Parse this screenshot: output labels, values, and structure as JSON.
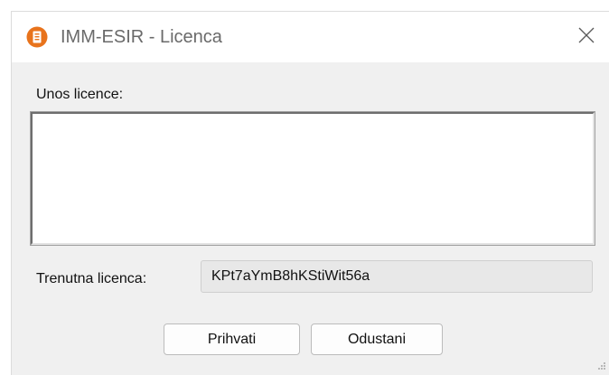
{
  "window": {
    "title": "IMM-ESIR - Licenca",
    "app_icon": "app-logo-icon",
    "close_icon": "close-icon",
    "accent_color": "#e8731c"
  },
  "form": {
    "license_input_label": "Unos licence:",
    "license_input_value": "",
    "current_license_label": "Trenutna licenca:",
    "current_license_value": "KPt7aYmB8hKStiWit56a"
  },
  "buttons": {
    "accept_label": "Prihvati",
    "cancel_label": "Odustani"
  }
}
